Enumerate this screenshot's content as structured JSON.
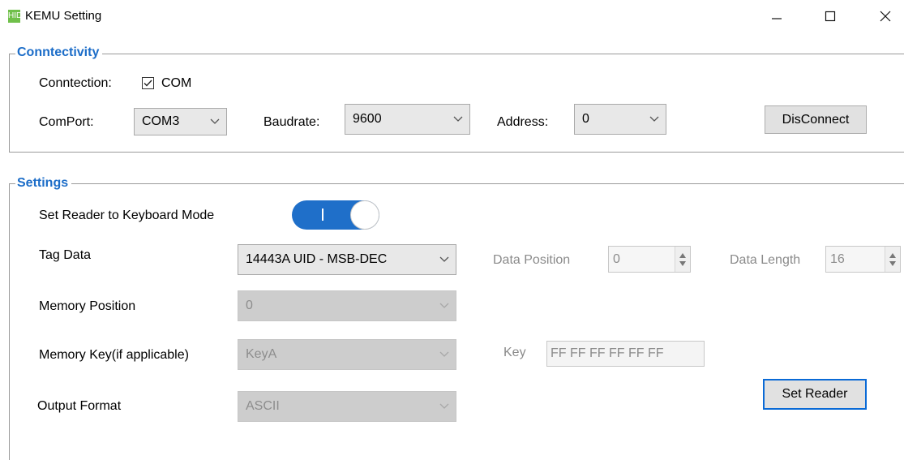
{
  "window": {
    "title": "KEMU Setting",
    "app_icon_text": "HID",
    "controls": [
      "minimize",
      "maximize",
      "close"
    ]
  },
  "connectivity": {
    "legend": "Conntectivity",
    "connection_label": "Conntection:",
    "com_checkbox": {
      "label": "COM",
      "checked": true
    },
    "comport_label": "ComPort:",
    "comport_value": "COM3",
    "baudrate_label": "Baudrate:",
    "baudrate_value": "9600",
    "address_label": "Address:",
    "address_value": "0",
    "disconnect_label": "DisConnect"
  },
  "settings": {
    "legend": "Settings",
    "keyboard_mode_label": "Set Reader to Keyboard Mode",
    "keyboard_mode_on": true,
    "tag_data_label": "Tag Data",
    "tag_data_value": "14443A UID - MSB-DEC",
    "data_position_label": "Data Position",
    "data_position_value": "0",
    "data_length_label": "Data Length",
    "data_length_value": "16",
    "memory_position_label": "Memory Position",
    "memory_position_value": "0",
    "memory_key_label": "Memory Key(if applicable)",
    "memory_key_value": "KeyA",
    "key_label": "Key",
    "key_value": "FF FF FF FF FF FF",
    "output_format_label": "Output Format",
    "output_format_value": "ASCII",
    "set_reader_label": "Set Reader"
  },
  "colors": {
    "accent": "#1c6dc8",
    "toggle_on": "#1f6fc9",
    "focus_border": "#0a6ad6",
    "app_icon": "#70c04a"
  }
}
